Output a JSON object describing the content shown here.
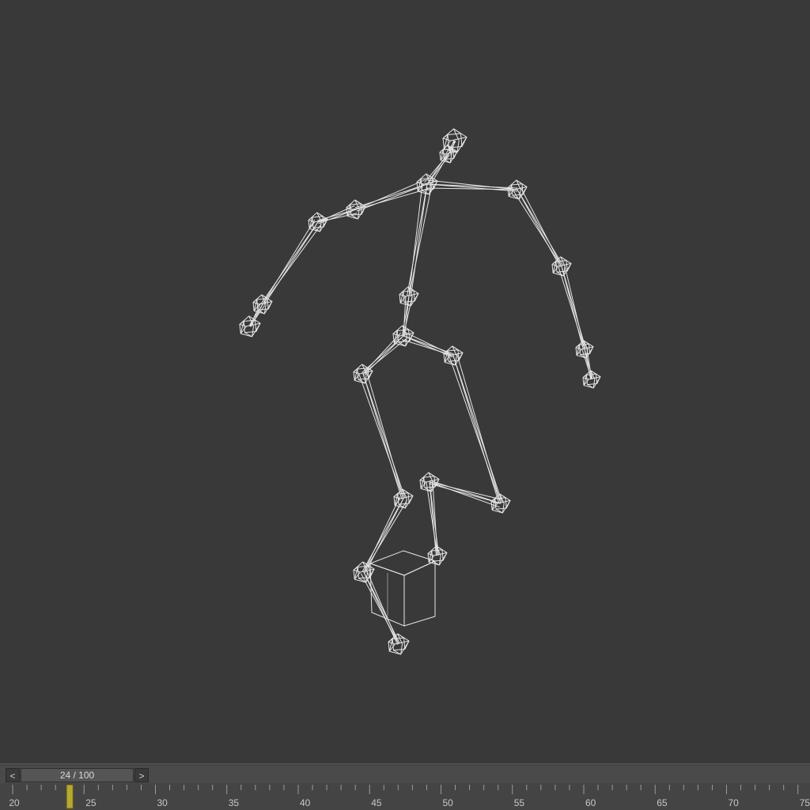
{
  "timeline": {
    "prev_label": "<",
    "next_label": ">",
    "frame_display": "24 / 100",
    "current_frame": 24,
    "total_frames": 100,
    "tick_labels": [
      "20",
      "25",
      "30",
      "35",
      "40",
      "45",
      "50",
      "55",
      "60",
      "65",
      "70",
      "75"
    ],
    "marker_color": "#b8a830"
  },
  "viewport": {
    "background": "#393939",
    "wire_color": "#e6e6e6"
  }
}
